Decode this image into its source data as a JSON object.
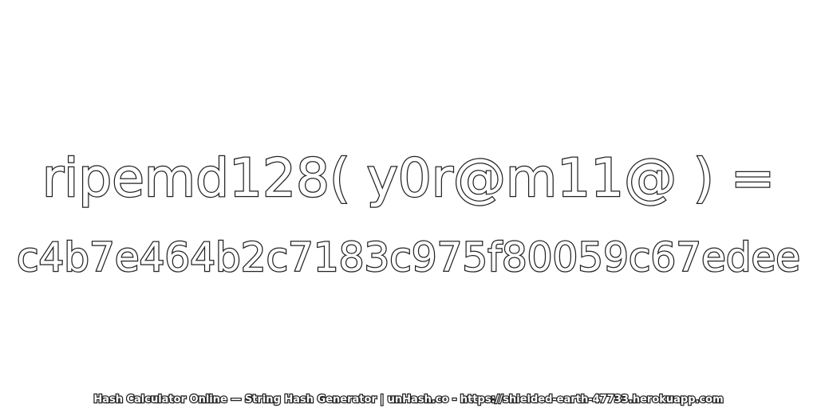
{
  "expression": "ripemd128( y0r@m11@ ) =",
  "hash": "c4b7e464b2c7183c975f80059c67edee",
  "footer": "Hash Calculator Online — String Hash Generator | unHash.co - https://shielded-earth-47733.herokuapp.com",
  "colors": {
    "background": "#ffffff",
    "text_fill": "#ffffff",
    "text_outline": "#222222"
  }
}
